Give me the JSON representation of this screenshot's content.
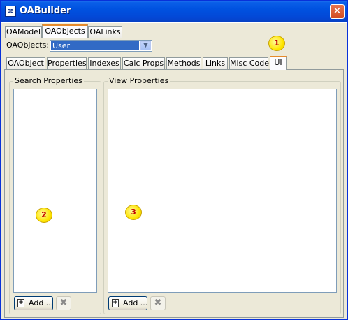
{
  "window": {
    "title": "OABuilder",
    "icon_text": "OB",
    "close_glyph": "✕"
  },
  "top_tabs": [
    "OAModel",
    "OAObjects",
    "OALinks"
  ],
  "object_selector": {
    "label": "OAObjects:",
    "value": "User",
    "arrow": "▼"
  },
  "sub_tabs": [
    "OAObject",
    "Properties",
    "Indexes",
    "Calc Props",
    "Methods",
    "Links",
    "Misc Code",
    "UI"
  ],
  "search_panel": {
    "title": "Search Properties",
    "add_label": "Add ...",
    "add_icon": "+",
    "remove_icon": "✖"
  },
  "view_panel": {
    "title": "View Properties",
    "add_label": "Add ...",
    "add_icon": "+",
    "remove_icon": "✖"
  },
  "markers": [
    "1",
    "2",
    "3"
  ],
  "colors": {
    "titlebar": "#0052e0",
    "active_tab_accent": "#e68b2c",
    "selection": "#316ac5",
    "marker": "#ffe600",
    "marker_text": "#c00000"
  }
}
